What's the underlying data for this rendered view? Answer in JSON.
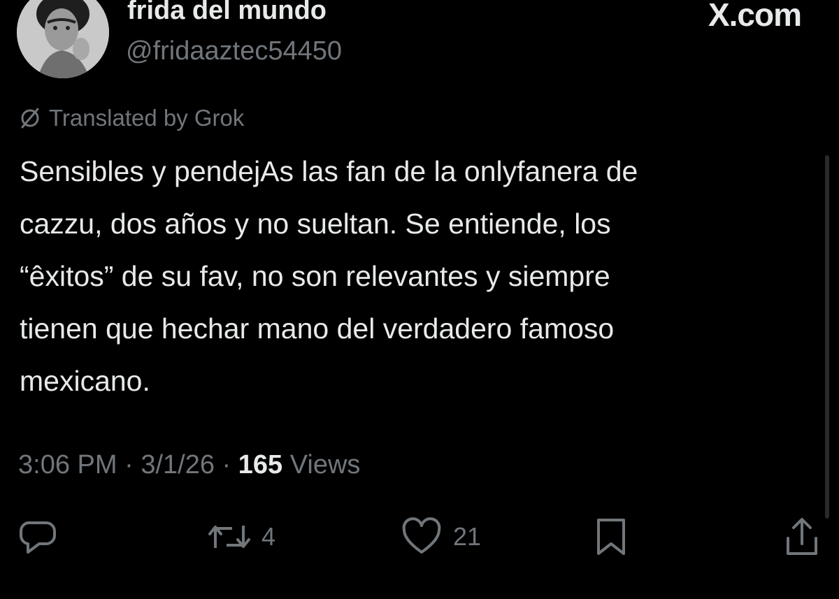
{
  "header": {
    "display_name": "frida del mundo",
    "handle": "@fridaaztec54450",
    "brand": "X.com"
  },
  "icons": {
    "avatar": "avatar-portrait",
    "translate": "slashed-circle-icon",
    "reply": "speech-bubble-icon",
    "retweet": "retweet-arrows-icon",
    "like": "heart-icon",
    "bookmark": "bookmark-icon",
    "share": "share-upload-icon"
  },
  "translation": {
    "label": "Translated by Grok"
  },
  "tweet": {
    "lines": [
      "Sensibles y pendejAs las fan de la onlyfanera de",
      "cazzu, dos años y no sueltan. Se entiende, los",
      "“êxitos” de su fav, no son relevantes y siempre",
      "tienen que hechar mano del verdadero famoso",
      "mexicano."
    ]
  },
  "meta": {
    "time": "3:06 PM",
    "date": "3/1/26",
    "separator": "·",
    "views_count": "165",
    "views_label": "Views"
  },
  "actions": {
    "retweets": "4",
    "likes": "21"
  },
  "colors": {
    "background": "#000000",
    "text_primary": "#e7e9ea",
    "text_secondary": "#71767b"
  }
}
